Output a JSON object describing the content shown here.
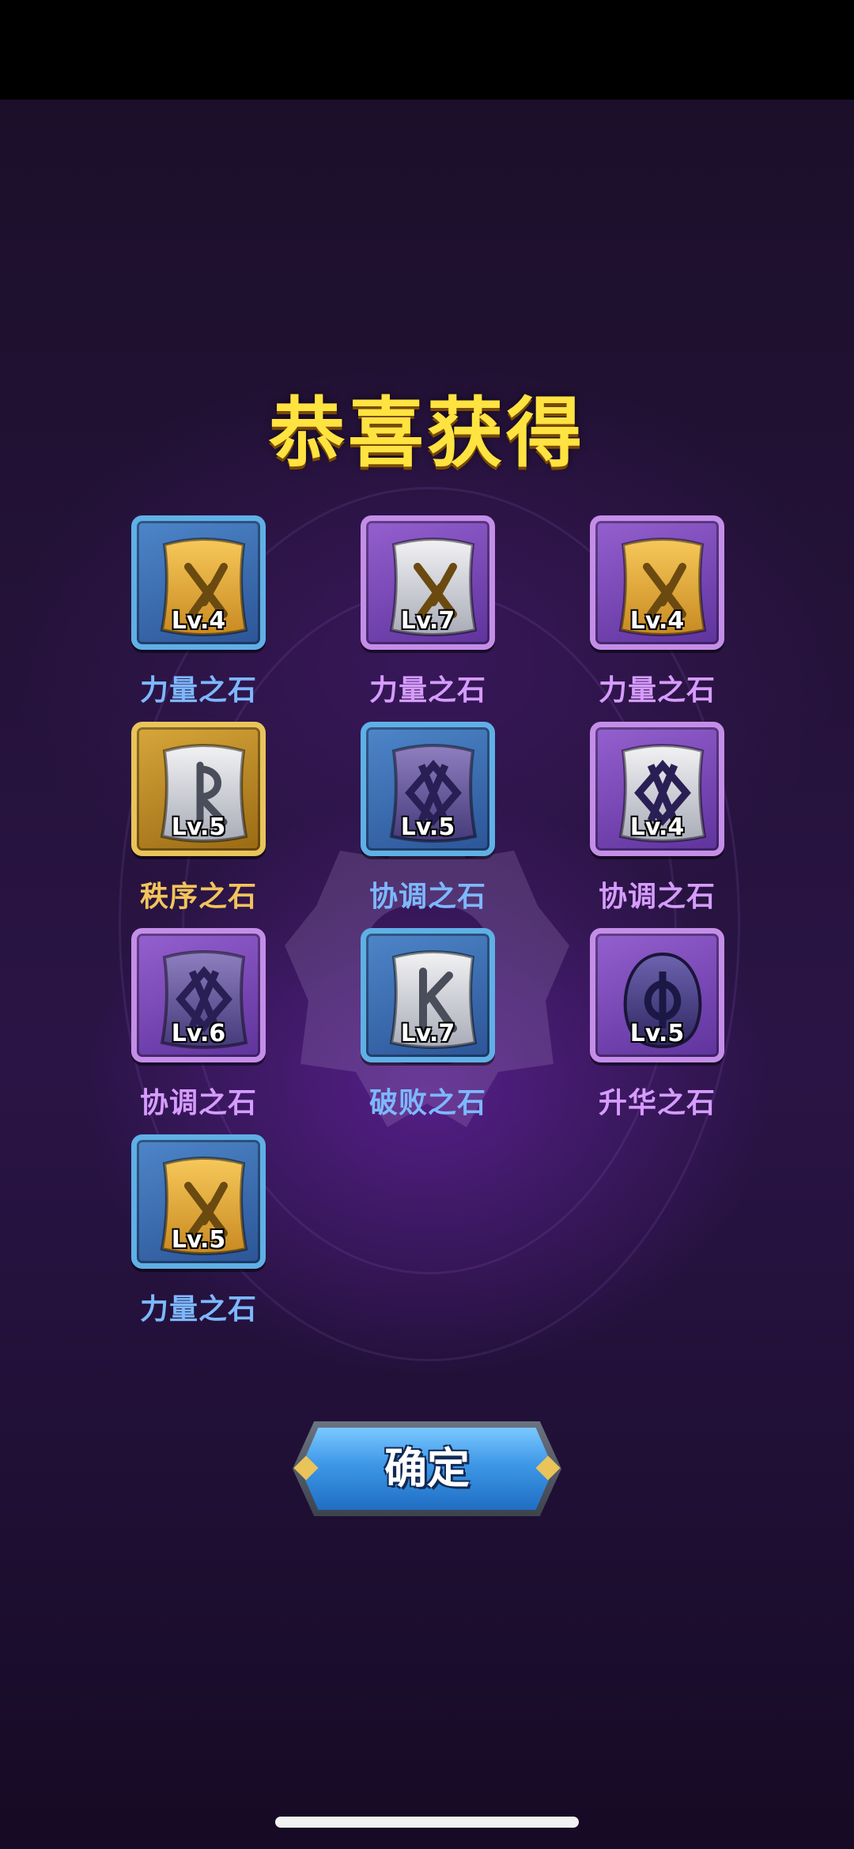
{
  "dialog": {
    "title": "恭喜获得",
    "confirm_label": "确定"
  },
  "rewards": [
    {
      "name": "力量之石",
      "level": "Lv.4",
      "frame": "blue",
      "stone": "gold",
      "rune": "x"
    },
    {
      "name": "力量之石",
      "level": "Lv.7",
      "frame": "purple",
      "stone": "silver",
      "rune": "x"
    },
    {
      "name": "力量之石",
      "level": "Lv.4",
      "frame": "purple",
      "stone": "gold",
      "rune": "x"
    },
    {
      "name": "秩序之石",
      "level": "Lv.5",
      "frame": "gold",
      "stone": "silver",
      "rune": "order"
    },
    {
      "name": "协调之石",
      "level": "Lv.5",
      "frame": "blue",
      "stone": "dark",
      "rune": "diamond"
    },
    {
      "name": "协调之石",
      "level": "Lv.4",
      "frame": "purple",
      "stone": "silver",
      "rune": "diamond"
    },
    {
      "name": "协调之石",
      "level": "Lv.6",
      "frame": "purple",
      "stone": "dark",
      "rune": "diamond"
    },
    {
      "name": "破败之石",
      "level": "Lv.7",
      "frame": "blue",
      "stone": "silver",
      "rune": "k"
    },
    {
      "name": "升华之石",
      "level": "Lv.5",
      "frame": "purple",
      "stone": "dark-oval",
      "rune": "phi"
    },
    {
      "name": "力量之石",
      "level": "Lv.5",
      "frame": "blue",
      "stone": "gold",
      "rune": "x"
    }
  ],
  "name_colors": {
    "blue": "#7db8ff",
    "purple": "#d69cff",
    "gold": "#f2c45a"
  },
  "title_color": "#ffe341"
}
